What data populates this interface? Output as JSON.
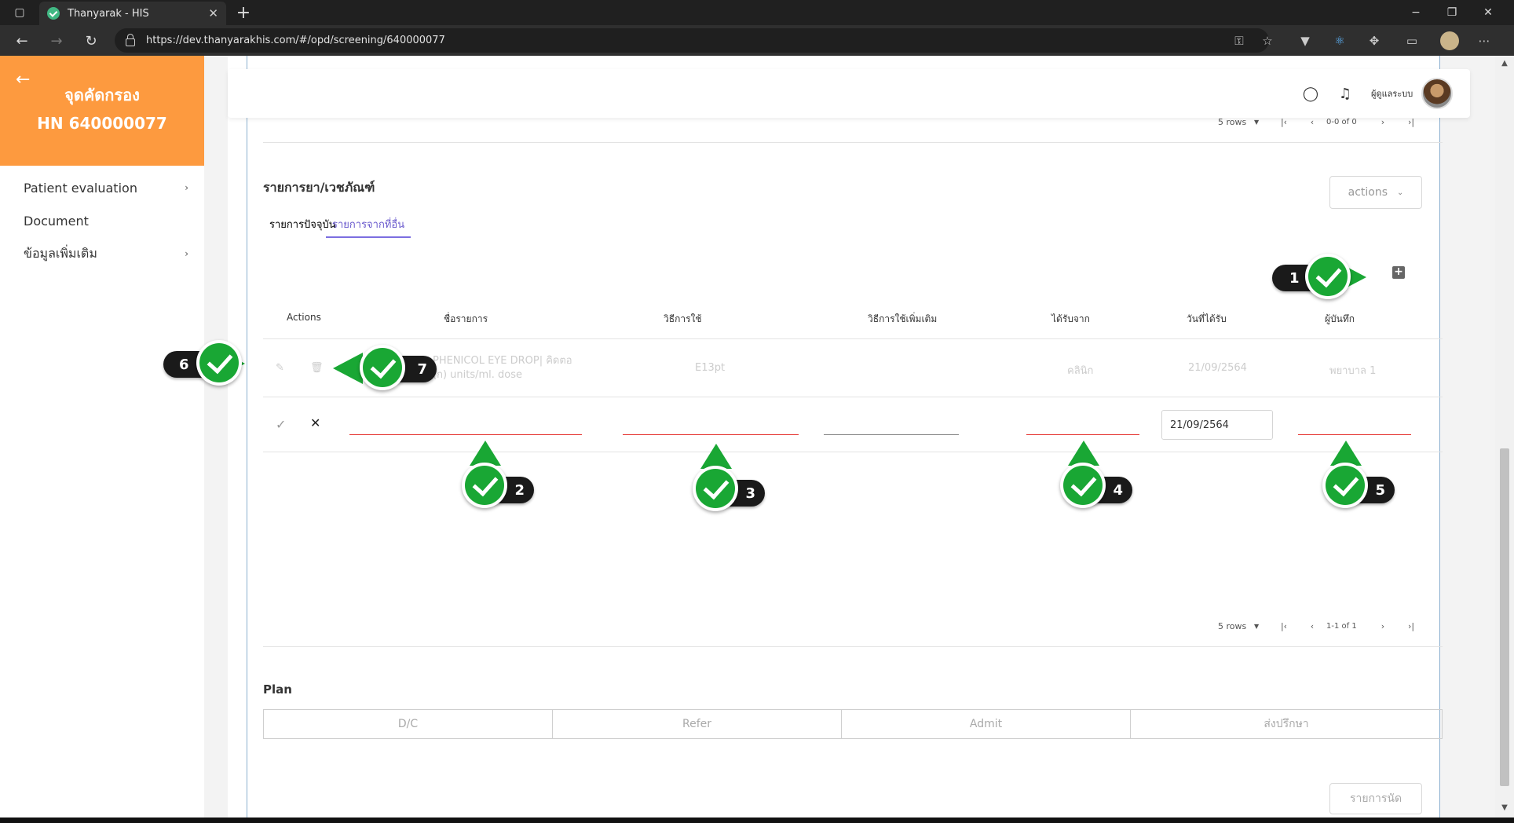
{
  "browser": {
    "tab_title": "Thanyarak - HIS",
    "url": "https://dev.thanyarakhis.com/#/opd/screening/640000077",
    "min": "−",
    "restore": "❐",
    "close": "✕",
    "new_tab": "+",
    "tab_close": "✕"
  },
  "sidebar": {
    "back_icon": "arrow-left-icon",
    "title": "จุดคัดกรอง",
    "hn": "HN 640000077",
    "items": [
      {
        "label": "Patient evaluation",
        "chevron": true
      },
      {
        "label": "Document",
        "chevron": false
      },
      {
        "label": "ข้อมูลเพิ่มเติม",
        "chevron": true
      }
    ]
  },
  "topbar": {
    "user_name": "ผู้ดูแลระบบ"
  },
  "pager_top": {
    "rows": "5 rows",
    "range": "0-0 of 0"
  },
  "medication": {
    "title": "รายการยา/เวชภัณฑ์",
    "actions_label": "actions",
    "tabs": [
      "รายการปัจจุบัน",
      "รายการจากที่อื่น"
    ],
    "active_tab": 1,
    "columns": [
      "Actions",
      "ชื่อรายการ",
      "วิธีการใช้",
      "วิธีการใช้เพิ่มเติม",
      "ได้รับจาก",
      "วันที่ได้รับ",
      "ผู้บันทึก"
    ],
    "row": {
      "name_line1": "PHENICOL EYE DROP| คิดตอ",
      "name_line2": "(ก) units/ml. dose",
      "usage": "E13pt",
      "from": "คลินิก",
      "date": "21/09/2564",
      "recorder": "พยาบาล 1"
    },
    "edit_row": {
      "date_value": "21/09/2564"
    },
    "pager": {
      "rows": "5 rows",
      "range": "1-1 of 1"
    }
  },
  "plan": {
    "title": "Plan",
    "buttons": [
      "D/C",
      "Refer",
      "Admit",
      "ส่งปรึกษา"
    ]
  },
  "appointment_label": "รายการนัด",
  "markers": [
    "1",
    "2",
    "3",
    "4",
    "5",
    "6",
    "7"
  ],
  "colors": {
    "sidebar_header": "#fd9a3f",
    "tab_active": "#7b6ee0",
    "marker_green": "#19a734",
    "error_line": "#e53935"
  }
}
